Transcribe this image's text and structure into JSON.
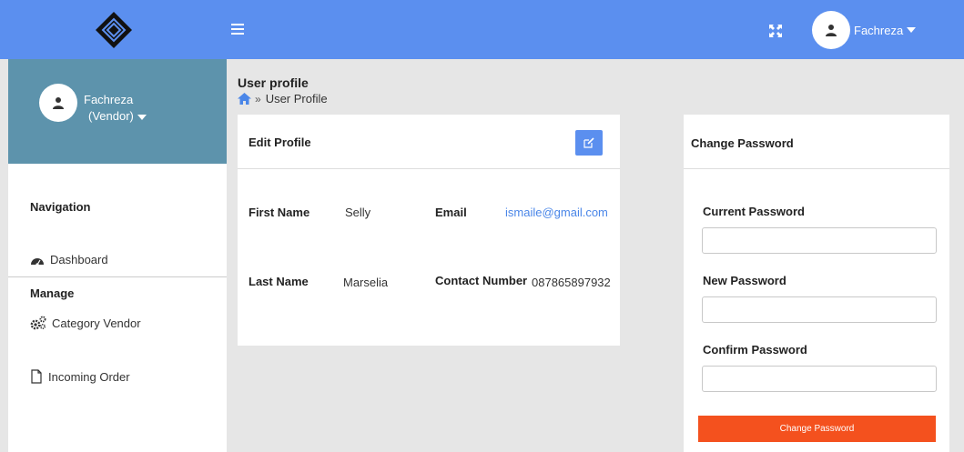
{
  "header": {
    "logo_icon": "diamond-logo",
    "menu_icon": "hamburger-icon",
    "fullscreen_icon": "expand-icon",
    "user_name": "Fachreza",
    "colors": {
      "topbar": "#5b8fef"
    }
  },
  "sidebar": {
    "user_name": "Fachreza",
    "user_role": "(Vendor)",
    "navigation_heading": "Navigation",
    "dashboard_label": "Dashboard",
    "manage_heading": "Manage",
    "category_vendor_label": "Category Vendor",
    "incoming_order_label": "Incoming Order",
    "colors": {
      "profile_bg": "#5d93ac"
    }
  },
  "page": {
    "title": "User profile",
    "breadcrumb_separator": "»",
    "breadcrumb_current": "User Profile"
  },
  "edit_profile": {
    "heading": "Edit Profile",
    "first_name_label": "First Name",
    "first_name_value": "Selly",
    "last_name_label": "Last Name",
    "last_name_value": "Marselia",
    "email_label": "Email",
    "email_value": "ismaile@gmail.com",
    "contact_label": "Contact Number",
    "contact_value": "087865897932"
  },
  "change_password": {
    "heading": "Change Password",
    "current_label": "Current Password",
    "current_value": "",
    "new_label": "New Password",
    "new_value": "",
    "confirm_label": "Confirm Password",
    "confirm_value": "",
    "button_label": "Change Password",
    "colors": {
      "button": "#f4511e"
    }
  }
}
